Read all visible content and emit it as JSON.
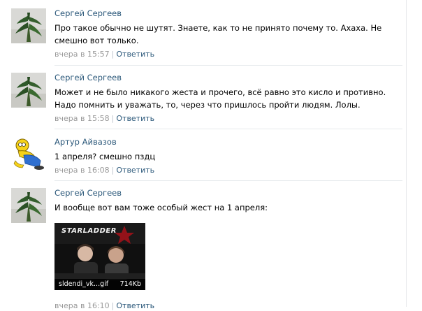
{
  "comments": [
    {
      "author": "Сергей Сергеев",
      "text": "Про такое обычно не шутят. Знаете, как то не принято почему то. Ахаха. Не смешно вот только.",
      "time": "вчера в 15:57",
      "separator": "|",
      "reply": "Ответить",
      "avatar_icon": "plant-avatar-icon"
    },
    {
      "author": "Сергей Сергеев",
      "text": "Может и не было никакого жеста и прочего, всё равно это кисло и противно. Надо помнить и уважать, то, через что пришлось пройти людям. Лолы.",
      "time": "вчера в 15:58",
      "separator": "|",
      "reply": "Ответить",
      "avatar_icon": "plant-avatar-icon"
    },
    {
      "author": "Артур Айвазов",
      "text": "1 апреля? смешно пздц",
      "time": "вчера в 16:08",
      "separator": "|",
      "reply": "Ответить",
      "avatar_icon": "cartoon-avatar-icon"
    },
    {
      "author": "Сергей Сергеев",
      "text": "И вообще вот вам тоже особый жест на 1 апреля:",
      "time": "вчера в 16:10",
      "separator": "|",
      "reply": "Ответить",
      "avatar_icon": "plant-avatar-icon",
      "attachment": {
        "filename": "sldendi_vk...gif",
        "size": "714Kb",
        "brand": "STARLADDER"
      }
    }
  ],
  "colors": {
    "link": "#2b587a",
    "meta": "#999999",
    "divider": "#e7eaed"
  }
}
